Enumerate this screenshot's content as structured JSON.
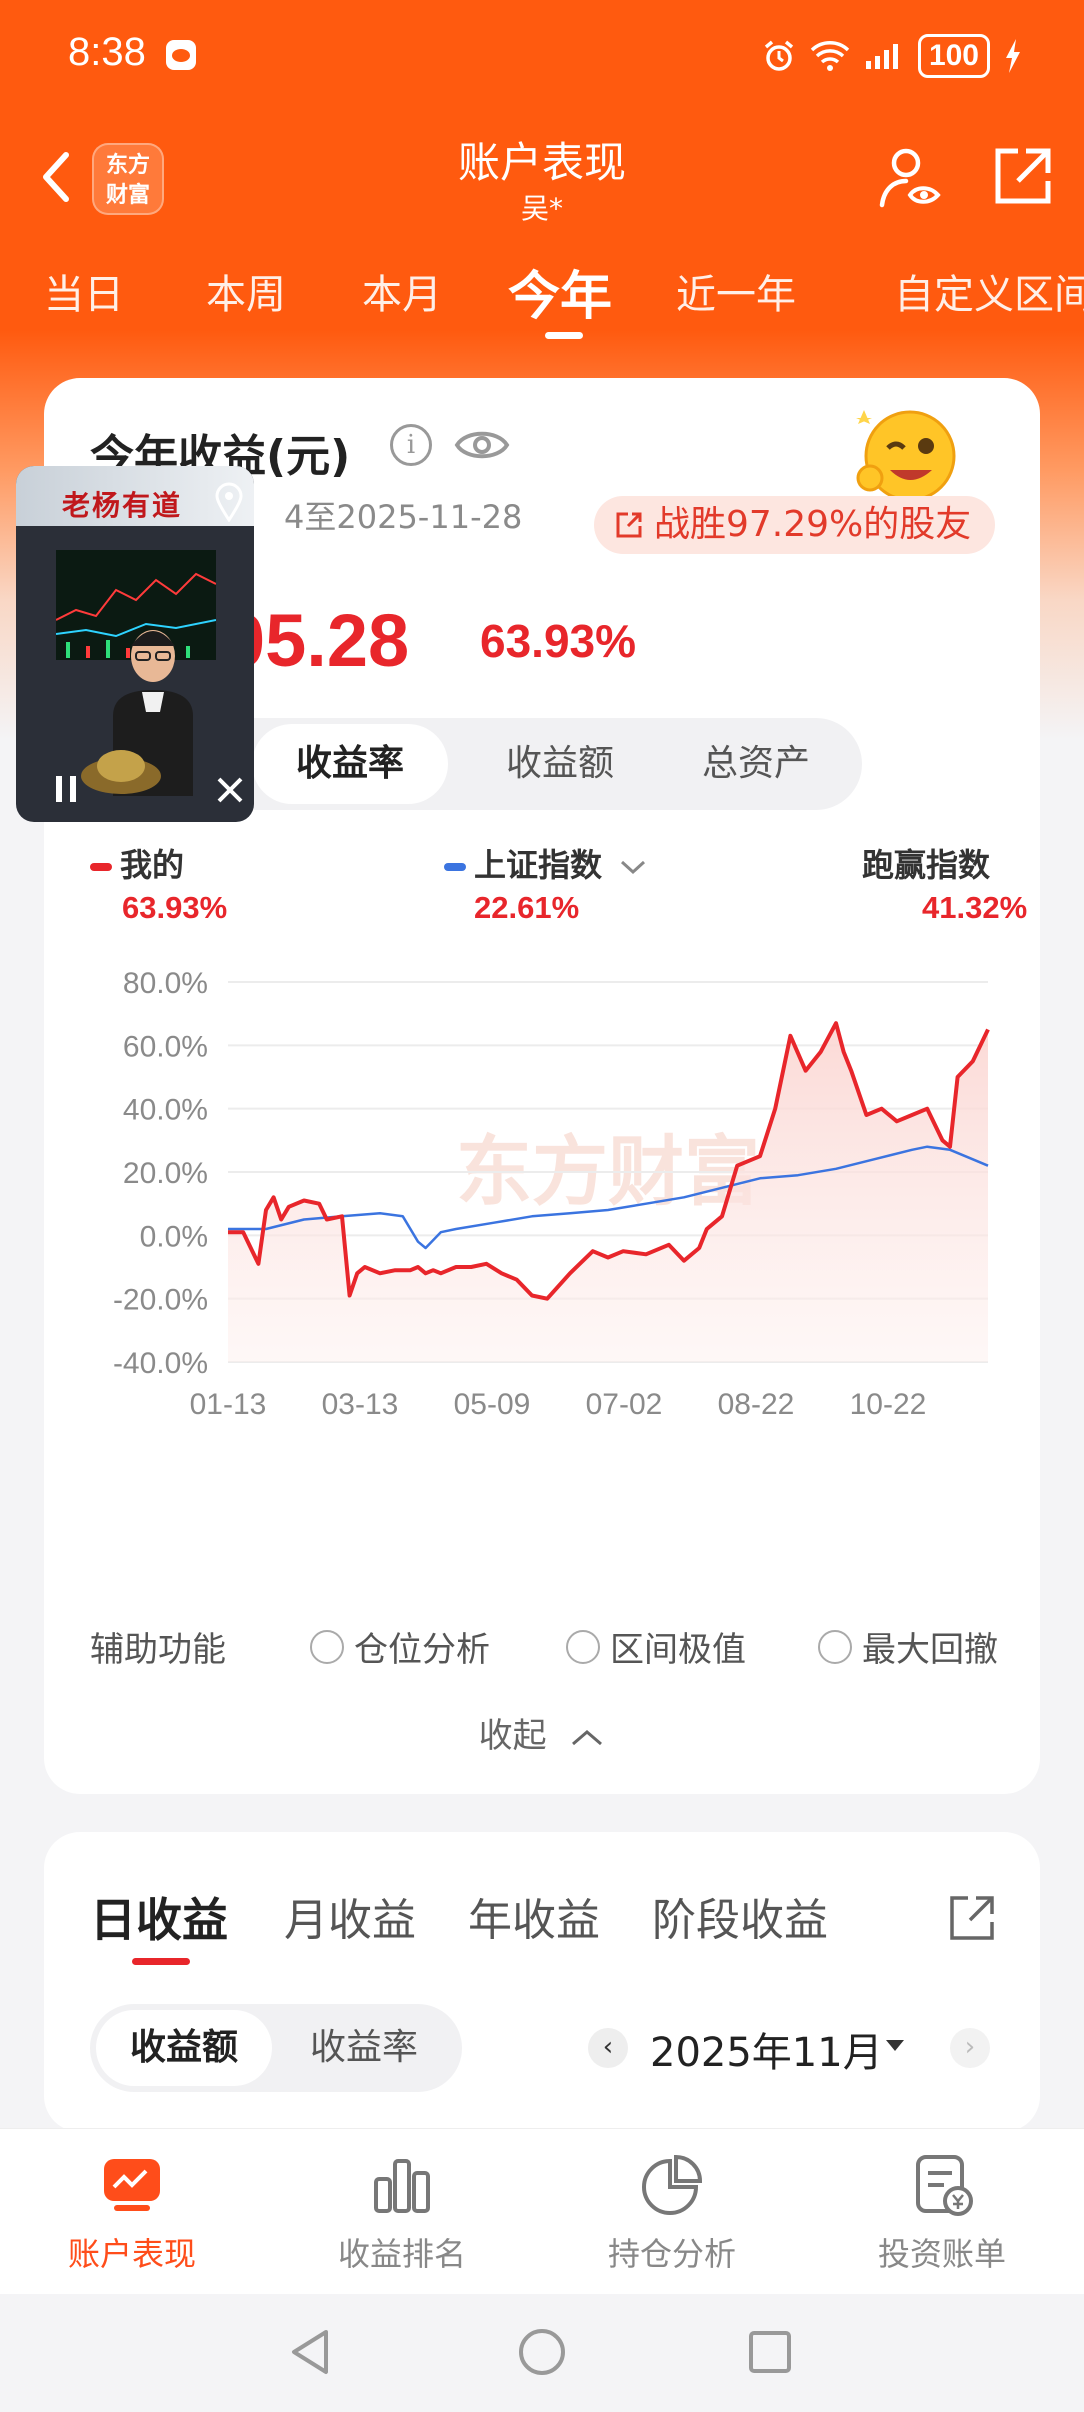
{
  "status": {
    "time": "8:38",
    "battery": "100"
  },
  "header": {
    "logo_text": "东方\n财富",
    "title": "账户表现",
    "subtitle": "吴*"
  },
  "period_tabs": [
    "当日",
    "本周",
    "本月",
    "今年",
    "近一年",
    "自定义区间"
  ],
  "active_period_index": 3,
  "summary": {
    "title": "今年收益(元)",
    "date_range_visible": "4至2025-11-28",
    "beat_badge": "战胜97.29%的股友",
    "profit_visible": "05.28",
    "rate": "63.93%",
    "metric_tabs": [
      "收益率",
      "收益额",
      "总资产"
    ],
    "active_metric_index": 0
  },
  "legend": [
    {
      "label": "我的",
      "value": "63.93%",
      "color": "#e8262b"
    },
    {
      "label": "上证指数",
      "value": "22.61%",
      "color": "#3b74e0"
    },
    {
      "label": "跑赢指数",
      "value": "41.32%",
      "color": "#e8262b"
    }
  ],
  "chart_data": {
    "type": "line",
    "x_tick_labels": [
      "01-13",
      "03-13",
      "05-09",
      "07-02",
      "08-22",
      "10-22"
    ],
    "y_tick_labels": [
      "80.0%",
      "60.0%",
      "40.0%",
      "20.0%",
      "0.0%",
      "-20.0%",
      "-40.0%"
    ],
    "ylim": [
      -40,
      80
    ],
    "watermark": "东方财富",
    "series": [
      {
        "name": "我的",
        "color": "#e8262b",
        "x": [
          0,
          2,
          4,
          5,
          6,
          7,
          8,
          10,
          12,
          13,
          15,
          16,
          17,
          18,
          20,
          22,
          24,
          25,
          26,
          27,
          28,
          30,
          32,
          34,
          36,
          38,
          40,
          42,
          45,
          48,
          50,
          52,
          55,
          58,
          60,
          62,
          63,
          65,
          67,
          70,
          72,
          74,
          76,
          78,
          80,
          81,
          82,
          84,
          86,
          88,
          90,
          92,
          94,
          95,
          96,
          98,
          100
        ],
        "y": [
          1,
          1,
          -9,
          8,
          12,
          5,
          9,
          11,
          10,
          5,
          6,
          -19,
          -12,
          -10,
          -12,
          -11,
          -11,
          -10,
          -12,
          -11,
          -12,
          -10,
          -10,
          -9,
          -12,
          -14,
          -19,
          -20,
          -12,
          -5,
          -7,
          -5,
          -6,
          -3,
          -8,
          -4,
          2,
          6,
          22,
          25,
          40,
          63,
          52,
          58,
          67,
          58,
          52,
          38,
          40,
          36,
          38,
          40,
          30,
          28,
          50,
          55,
          65
        ],
        "final_label": "63.93%"
      },
      {
        "name": "上证指数",
        "color": "#3b74e0",
        "x": [
          0,
          5,
          10,
          15,
          20,
          23,
          25,
          26,
          28,
          30,
          35,
          40,
          45,
          50,
          55,
          60,
          65,
          70,
          75,
          80,
          85,
          90,
          92,
          95,
          98,
          100
        ],
        "y": [
          2,
          2,
          5,
          6,
          7,
          6,
          -2,
          -4,
          1,
          2,
          4,
          6,
          7,
          8,
          10,
          12,
          15,
          18,
          19,
          21,
          24,
          27,
          28,
          27,
          24,
          22
        ],
        "final_label": "22.61%"
      }
    ]
  },
  "aux": {
    "label": "辅助功能",
    "options": [
      "仓位分析",
      "区间极值",
      "最大回撤"
    ],
    "collapse_label": "收起"
  },
  "daily": {
    "tabs": [
      "日收益",
      "月收益",
      "年收益",
      "阶段收益"
    ],
    "active_index": 0,
    "sub_tabs": [
      "收益额",
      "收益率"
    ],
    "active_sub_index": 0,
    "month": "2025年11月"
  },
  "pip": {
    "caption": "老杨有道"
  },
  "bottom_nav": [
    {
      "label": "账户表现",
      "active": true
    },
    {
      "label": "收益排名",
      "active": false
    },
    {
      "label": "持仓分析",
      "active": false
    },
    {
      "label": "投资账单",
      "active": false
    }
  ]
}
